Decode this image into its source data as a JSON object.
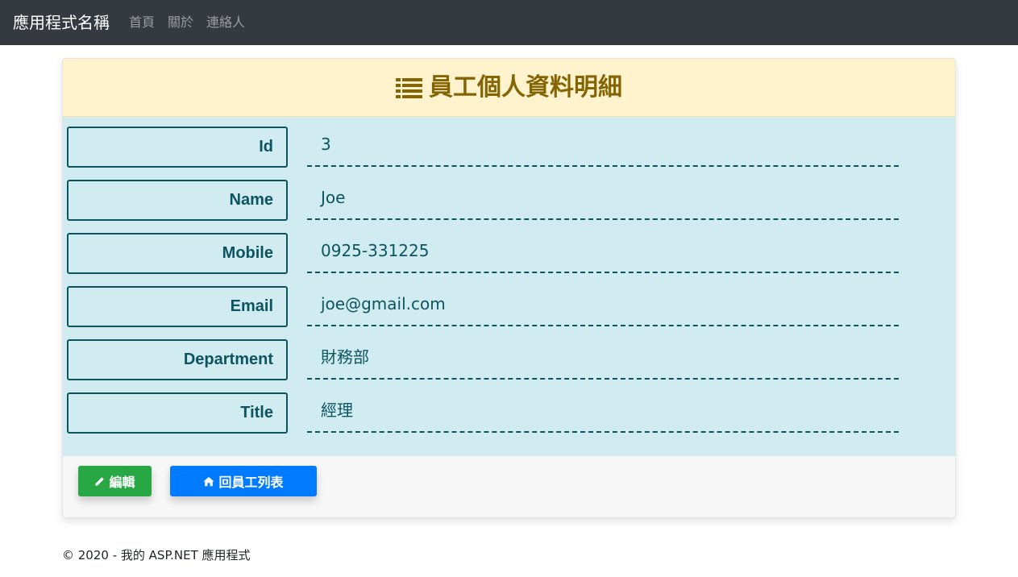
{
  "navbar": {
    "brand": "應用程式名稱",
    "links": [
      "首頁",
      "關於",
      "連絡人"
    ]
  },
  "card": {
    "title": "員工個人資料明細",
    "fields": [
      {
        "label": "Id",
        "value": "3"
      },
      {
        "label": "Name",
        "value": "Joe"
      },
      {
        "label": "Mobile",
        "value": "0925-331225"
      },
      {
        "label": "Email",
        "value": "joe@gmail.com"
      },
      {
        "label": "Department",
        "value": "財務部"
      },
      {
        "label": "Title",
        "value": "經理"
      }
    ],
    "buttons": {
      "edit_label": "編輯",
      "back_label": "回員工列表"
    }
  },
  "footer": {
    "text": "© 2020 - 我的 ASP.NET 應用程式"
  },
  "colors": {
    "navbar_bg": "#343a40",
    "header_bg": "#fff3cd",
    "header_text": "#856404",
    "body_bg": "#d1ecf1",
    "info_text": "#0c5460",
    "edit_btn": "#28a745",
    "back_btn": "#007bff"
  },
  "icons": {
    "title": "list-icon",
    "edit": "pencil-icon",
    "back": "home-icon"
  }
}
